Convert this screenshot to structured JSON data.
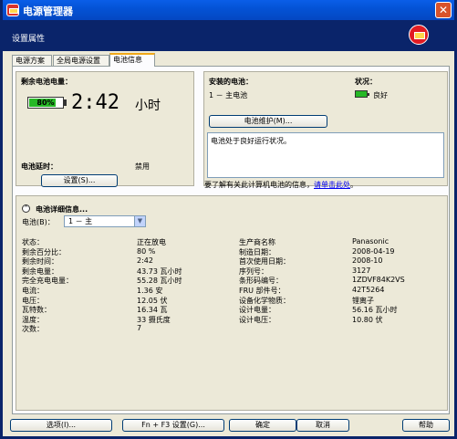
{
  "window": {
    "title": "电源管理器",
    "header_title": "设置属性",
    "icon": "battery-icon",
    "close_glyph": "✕"
  },
  "tabs": [
    {
      "label": "电源方案"
    },
    {
      "label": "全局电源设置"
    },
    {
      "label": "电池信息"
    }
  ],
  "remaining": {
    "label": "剩余电池电量：",
    "percent_text": "80%",
    "percent_value": 0.8,
    "time": "2:42",
    "unit": "小时"
  },
  "delay": {
    "label": "电池延时：",
    "status": "禁用",
    "button": "设置(S)..."
  },
  "installed": {
    "label": "安装的电池：",
    "battery": "1 － 主电池",
    "status_label": "状况：",
    "status_value": "良好",
    "maintenance_button": "电池维护(M)...",
    "message": "电池处于良好运行状况。",
    "more_info": "要了解有关此计算机电池的信息，",
    "more_link": "请单击此处",
    "more_suffix": "。"
  },
  "details": {
    "title": "电池详细信息...",
    "collapse_glyph": "⌃",
    "battery_label": "电池(B)：",
    "battery_select": "1 － 主",
    "left_rows": [
      {
        "k": "状态：",
        "v": "正在放电"
      },
      {
        "k": "剩余百分比：",
        "v": "80 %"
      },
      {
        "k": "剩余时间：",
        "v": "2:42"
      },
      {
        "k": "剩余电量：",
        "v": "43.73 瓦小时"
      },
      {
        "k": "完全充电电量：",
        "v": "55.28 瓦小时"
      },
      {
        "k": "电流：",
        "v": "1.36 安"
      },
      {
        "k": "电压：",
        "v": "12.05 伏"
      },
      {
        "k": "瓦特数：",
        "v": "16.34 瓦"
      },
      {
        "k": "温度：",
        "v": "33 摄氏度"
      },
      {
        "k": "次数：",
        "v": "7"
      }
    ],
    "right_rows": [
      {
        "k": "生产商名称",
        "v": "Panasonic"
      },
      {
        "k": "制造日期：",
        "v": "2008-04-19"
      },
      {
        "k": "首次使用日期：",
        "v": "2008-10"
      },
      {
        "k": "序列号：",
        "v": "3127"
      },
      {
        "k": "条形码编号：",
        "v": "1ZDVF84K2VS"
      },
      {
        "k": "FRU 部件号：",
        "v": "42T5264"
      },
      {
        "k": "设备化学物质：",
        "v": "锂离子"
      },
      {
        "k": "设计电量：",
        "v": "56.16 瓦小时"
      },
      {
        "k": "设计电压：",
        "v": "10.80 伏"
      }
    ]
  },
  "footer": {
    "options": "选项(I)...",
    "hotkey": "Fn + F3 设置(G)...",
    "ok": "确定",
    "cancel": "取消",
    "help": "帮助"
  }
}
